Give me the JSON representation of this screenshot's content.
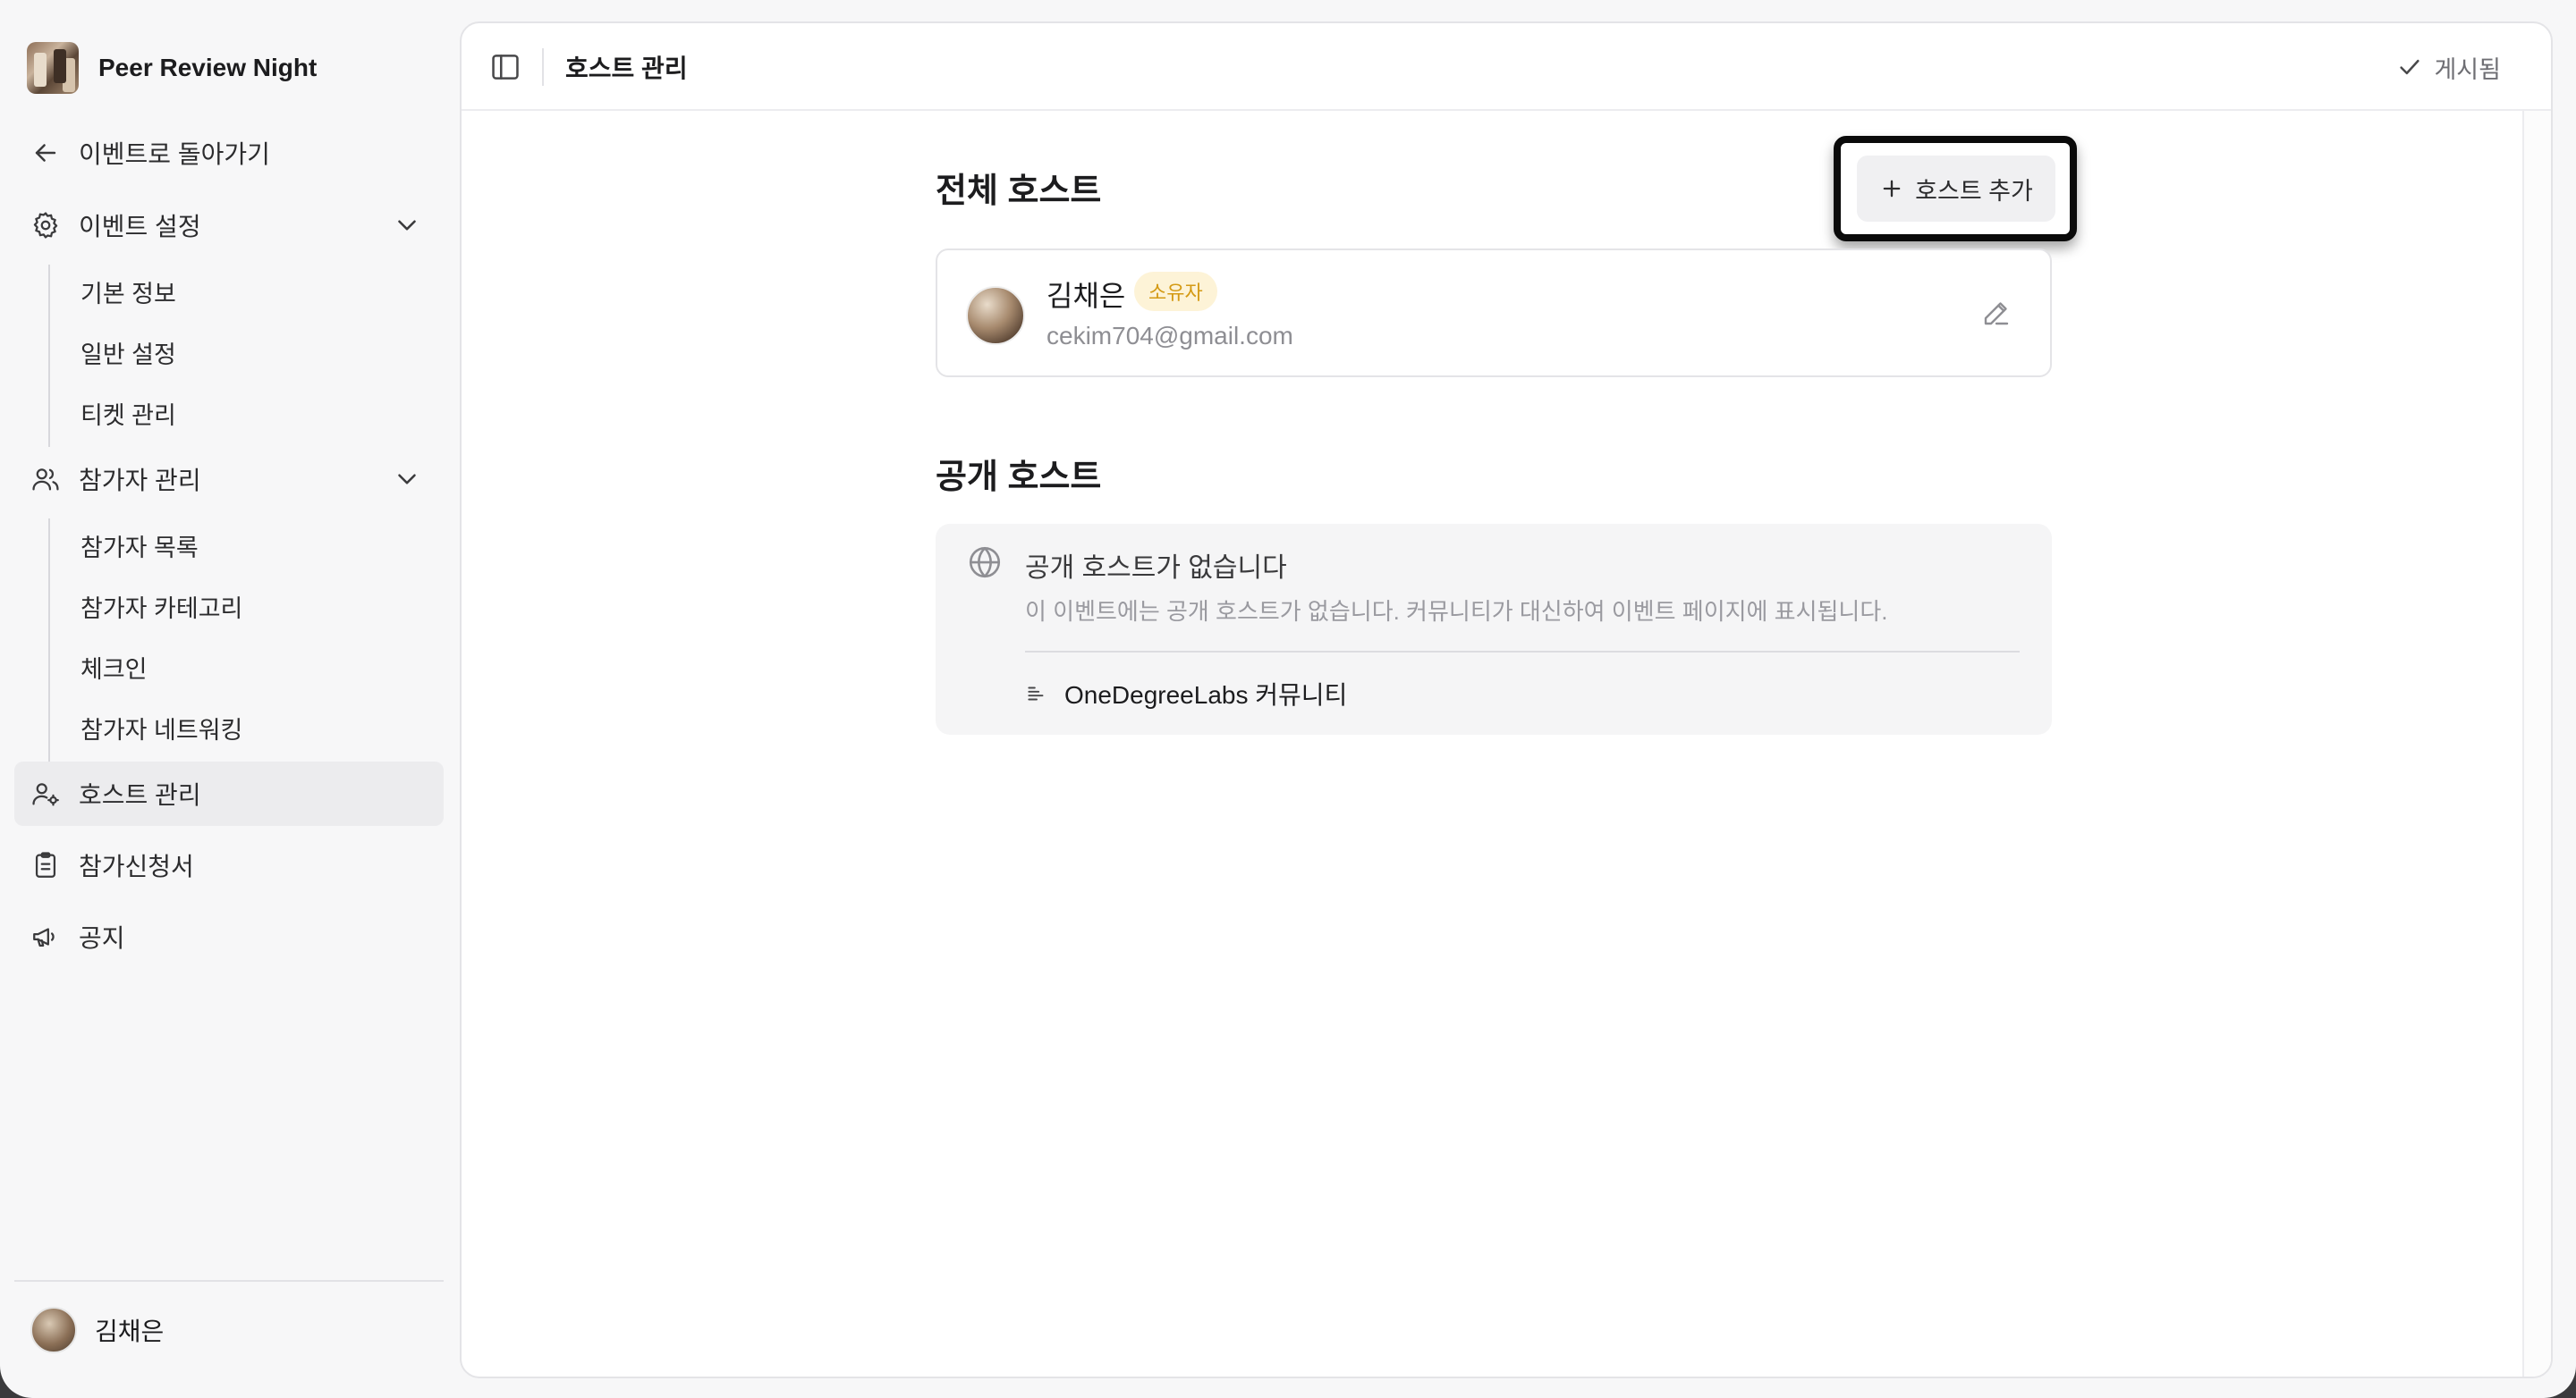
{
  "sidebar": {
    "brand": "Peer Review Night",
    "back": "이벤트로 돌아가기",
    "event_settings": {
      "label": "이벤트 설정",
      "items": [
        "기본 정보",
        "일반 설정",
        "티켓 관리"
      ]
    },
    "participants": {
      "label": "참가자 관리",
      "items": [
        "참가자 목록",
        "참가자 카테고리",
        "체크인",
        "참가자 네트워킹"
      ]
    },
    "host_management": "호스트 관리",
    "application": "참가신청서",
    "notice": "공지",
    "user_name": "김채은"
  },
  "topbar": {
    "title": "호스트 관리",
    "status": "게시됨"
  },
  "main": {
    "all_hosts_title": "전체 호스트",
    "add_host_label": "호스트 추가",
    "host": {
      "name": "김채은",
      "badge": "소유자",
      "email": "cekim704@gmail.com"
    },
    "public_hosts_title": "공개 호스트",
    "public_empty": {
      "title": "공개 호스트가 없습니다",
      "description": "이 이벤트에는 공개 호스트가 없습니다. 커뮤니티가 대신하여 이벤트 페이지에 표시됩니다.",
      "community": "OneDegreeLabs 커뮤니티"
    }
  },
  "colors": {
    "badge_text": "#d49a14",
    "badge_bg": "#fdf3d7",
    "active_nav_bg": "#ececee"
  }
}
